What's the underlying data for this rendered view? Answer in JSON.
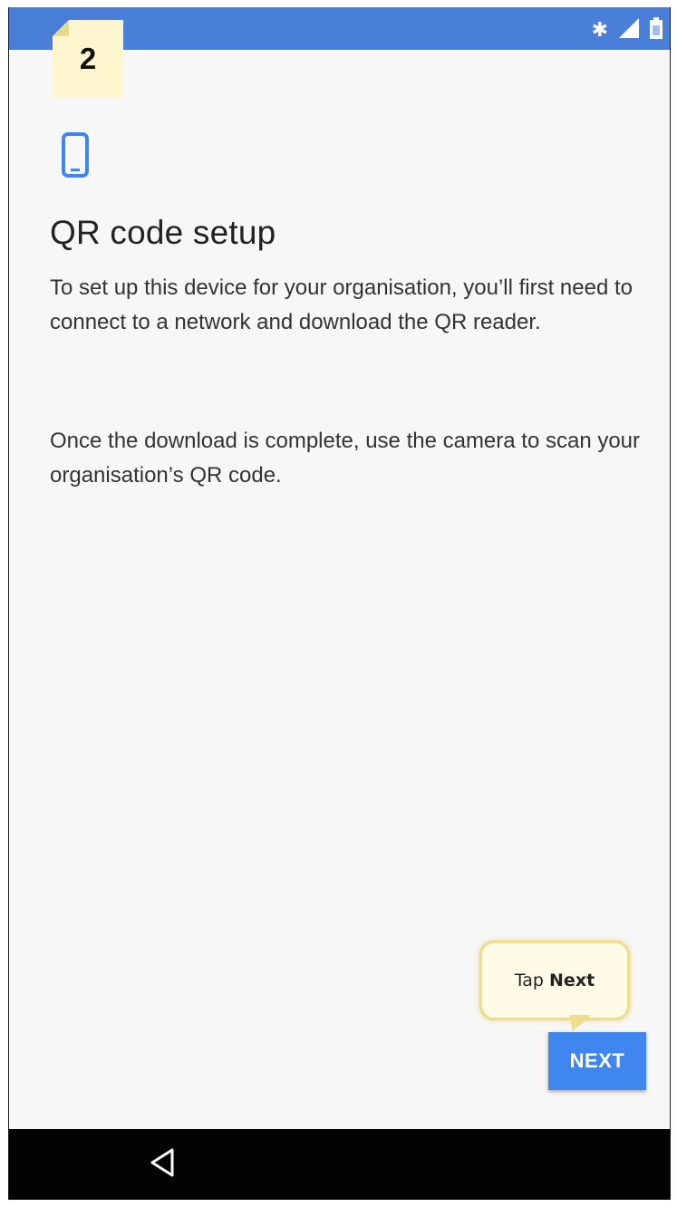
{
  "step": {
    "number": "2"
  },
  "status_bar": {
    "icons": [
      "bluetooth-icon",
      "signal-icon",
      "battery-icon"
    ],
    "color": "#4a7fd8"
  },
  "content": {
    "title": "QR code setup",
    "paragraph_1": "To set up this device for your organisation, you’ll first need to connect to a network and download the QR reader.",
    "paragraph_2": "Once the download is complete, use the camera to scan your organisation’s QR code.",
    "icon": "phone-icon"
  },
  "callout": {
    "prefix": "Tap ",
    "emphasis": "Next"
  },
  "actions": {
    "next_label": "NEXT",
    "accent": "#3f86ee"
  },
  "nav_bar": {
    "icons": [
      "back-icon"
    ]
  }
}
